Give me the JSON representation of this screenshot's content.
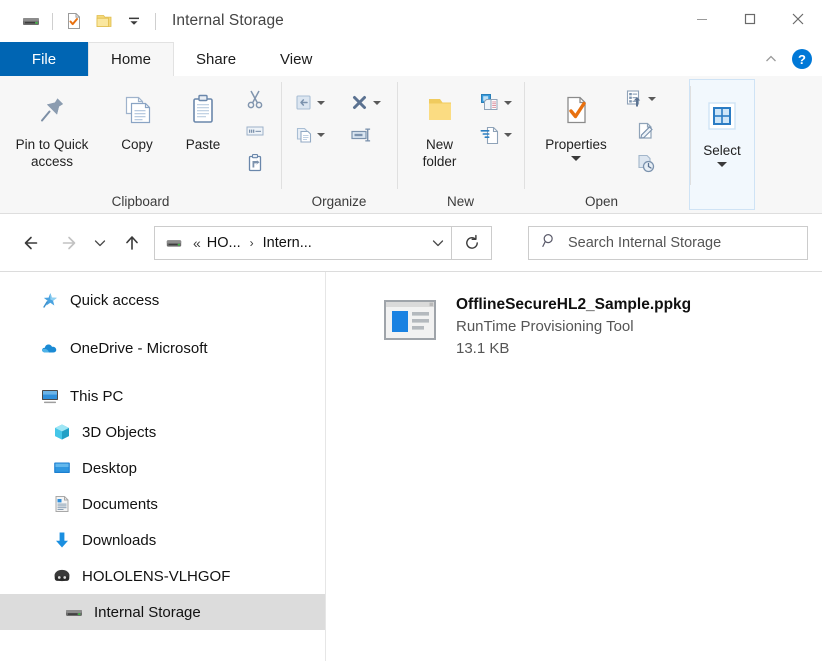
{
  "window": {
    "title": "Internal Storage",
    "quick_access_toolbar": [
      {
        "name": "drive-icon",
        "label": "Internal Storage"
      },
      {
        "name": "properties-icon",
        "label": "Properties"
      },
      {
        "name": "new-folder-icon",
        "label": "New folder"
      },
      {
        "name": "customize-chevron-icon",
        "label": "Customize Quick Access Toolbar"
      }
    ],
    "controls": {
      "minimize": "Minimize",
      "maximize": "Maximize",
      "close": "Close"
    }
  },
  "tabs": [
    {
      "label": "File",
      "active": false,
      "is_file_menu": true
    },
    {
      "label": "Home",
      "active": true,
      "is_file_menu": false
    },
    {
      "label": "Share",
      "active": false,
      "is_file_menu": false
    },
    {
      "label": "View",
      "active": false,
      "is_file_menu": false
    }
  ],
  "tabstrip_right": {
    "collapse_ribbon": "^",
    "help": "?"
  },
  "ribbon": {
    "groups": [
      {
        "name": "Clipboard",
        "label": "Clipboard",
        "buttons": [
          {
            "label": "Pin to Quick\naccess",
            "icon": "pin-icon"
          },
          {
            "label": "Copy",
            "icon": "copy-icon"
          },
          {
            "label": "Paste",
            "icon": "paste-icon"
          }
        ],
        "small_buttons": [
          {
            "label": "Cut",
            "icon": "scissors-icon"
          },
          {
            "label": "Copy path",
            "icon": "copy-path-icon"
          },
          {
            "label": "Paste shortcut",
            "icon": "paste-shortcut-icon"
          }
        ]
      },
      {
        "name": "Organize",
        "label": "Organize",
        "small_buttons": [
          {
            "label": "Move to",
            "icon": "move-to-icon",
            "has_caret": true
          },
          {
            "label": "Copy to",
            "icon": "copy-to-icon",
            "has_caret": true
          },
          {
            "label": "Delete",
            "icon": "delete-x-icon",
            "has_caret": true
          },
          {
            "label": "Rename",
            "icon": "rename-icon",
            "has_caret": false
          }
        ]
      },
      {
        "name": "New",
        "label": "New",
        "buttons": [
          {
            "label": "New\nfolder",
            "icon": "new-folder-icon"
          }
        ],
        "small_buttons": [
          {
            "label": "New item",
            "icon": "new-item-icon",
            "has_caret": true
          },
          {
            "label": "Easy access",
            "icon": "easy-access-icon",
            "has_caret": true
          }
        ]
      },
      {
        "name": "Open",
        "label": "Open",
        "buttons": [
          {
            "label": "Properties",
            "icon": "properties-icon",
            "has_caret": true
          }
        ],
        "small_buttons": [
          {
            "label": "Open",
            "icon": "open-icon",
            "has_caret": true
          },
          {
            "label": "Edit",
            "icon": "edit-icon",
            "has_caret": false
          },
          {
            "label": "History",
            "icon": "history-icon",
            "has_caret": false
          }
        ]
      },
      {
        "name": "Select",
        "label": "",
        "buttons": [
          {
            "label": "Select",
            "icon": "select-grid-icon",
            "has_caret": true
          }
        ]
      }
    ]
  },
  "addressbar": {
    "back": "Back",
    "forward": "Forward",
    "recent": "Recent locations",
    "up": "Up",
    "breadcrumb": {
      "icon": "drive-icon",
      "overflow": "«",
      "items": [
        "HO...",
        "Intern..."
      ],
      "dropdown": "Previous locations"
    },
    "refresh": "Refresh",
    "search": {
      "placeholder": "Search Internal Storage",
      "value": "",
      "icon": "search-icon"
    }
  },
  "sidebar": {
    "items": [
      {
        "label": "Quick access",
        "icon": "star-pin-icon",
        "indent": 0,
        "selected": false,
        "gap_after": true
      },
      {
        "label": "OneDrive - Microsoft",
        "icon": "onedrive-cloud-icon",
        "indent": 0,
        "selected": false,
        "gap_after": true
      },
      {
        "label": "This PC",
        "icon": "this-pc-monitor-icon",
        "indent": 0,
        "selected": false,
        "gap_after": false
      },
      {
        "label": "3D Objects",
        "icon": "3d-objects-icon",
        "indent": 1,
        "selected": false,
        "gap_after": false
      },
      {
        "label": "Desktop",
        "icon": "desktop-icon",
        "indent": 1,
        "selected": false,
        "gap_after": false
      },
      {
        "label": "Documents",
        "icon": "documents-icon",
        "indent": 1,
        "selected": false,
        "gap_after": false
      },
      {
        "label": "Downloads",
        "icon": "downloads-arrow-icon",
        "indent": 1,
        "selected": false,
        "gap_after": false
      },
      {
        "label": "HOLOLENS-VLHGOF",
        "icon": "hololens-device-icon",
        "indent": 1,
        "selected": false,
        "gap_after": false
      },
      {
        "label": "Internal Storage",
        "icon": "drive-icon",
        "indent": 2,
        "selected": true,
        "gap_after": false
      }
    ]
  },
  "content": {
    "files": [
      {
        "name": "OfflineSecureHL2_Sample.ppkg",
        "type": "RunTime Provisioning Tool",
        "size": "13.1 KB",
        "icon": "ppkg-file-icon"
      }
    ]
  },
  "colors": {
    "accent": "#0065b3",
    "ribbon_bg": "#f7f7f7",
    "selection": "#dcdcdc",
    "help_blue": "#0078d7",
    "folder_yellow": "#ffd966",
    "link_blue": "#0a7ad1"
  }
}
